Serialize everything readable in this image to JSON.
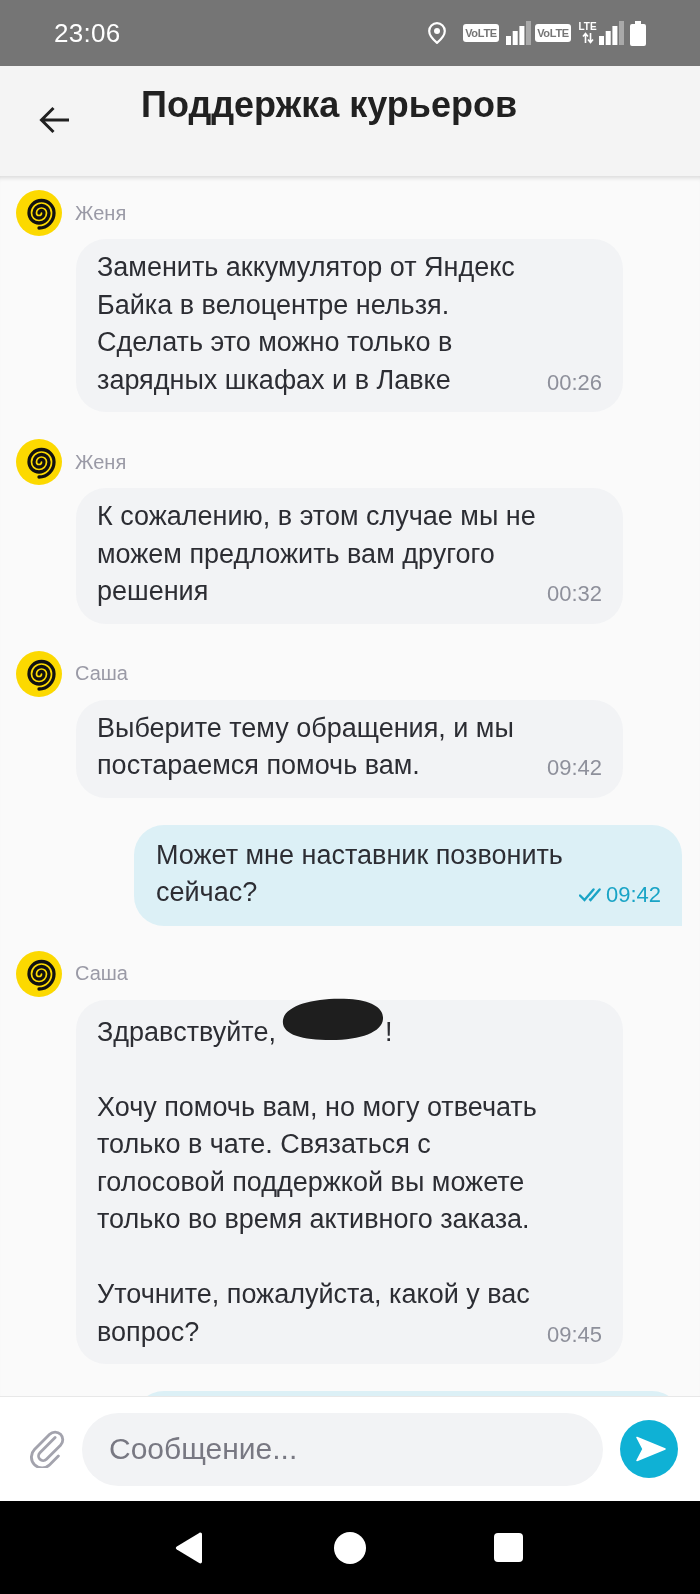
{
  "status_bar": {
    "time": "23:06",
    "sims": [
      {
        "volte_label": "VoLTE"
      },
      {
        "volte_label": "VoLTE",
        "network_label": "LTE"
      }
    ]
  },
  "header": {
    "title": "Поддержка курьеров"
  },
  "messages": [
    {
      "kind": "agent",
      "author": "Женя",
      "paragraphs": [
        {
          "parts": [
            {
              "kind": "text",
              "text": "Заменить аккумулятор от Яндекс Байка в велоцентре нельзя. Сделать это можно только в зарядных шкафах и в Лавке"
            }
          ]
        }
      ],
      "time": "00:26"
    },
    {
      "kind": "agent",
      "author": "Женя",
      "paragraphs": [
        {
          "parts": [
            {
              "kind": "text",
              "text": "К сожалению, в этом случае мы не можем предложить вам другого решения"
            }
          ]
        }
      ],
      "time": "00:32"
    },
    {
      "kind": "agent",
      "author": "Саша",
      "paragraphs": [
        {
          "parts": [
            {
              "kind": "text",
              "text": "Выберите тему обращения, и мы постараемся помочь вам."
            }
          ]
        }
      ],
      "time": "09:42"
    },
    {
      "kind": "user",
      "paragraphs": [
        {
          "parts": [
            {
              "kind": "text",
              "text": "Может мне наставник позвонить сейчас?"
            }
          ]
        }
      ],
      "time": "09:42",
      "read": true
    },
    {
      "kind": "agent",
      "author": "Саша",
      "paragraphs": [
        {
          "parts": [
            {
              "kind": "text",
              "text": "Здравствуйте,"
            },
            {
              "kind": "redacted"
            },
            {
              "kind": "text",
              "text": "!"
            }
          ]
        },
        {
          "parts": [
            {
              "kind": "text",
              "text": "Хочу помочь вам, но могу отвечать только в чате. Связаться с голосовой поддержкой вы можете только во время активного заказа."
            }
          ]
        },
        {
          "parts": [
            {
              "kind": "text",
              "text": "Уточните, пожалуйста, какой у вас вопрос?"
            }
          ]
        }
      ],
      "time": "09:45"
    },
    {
      "kind": "cut-off"
    }
  ],
  "composer": {
    "placeholder": "Сообщение..."
  }
}
